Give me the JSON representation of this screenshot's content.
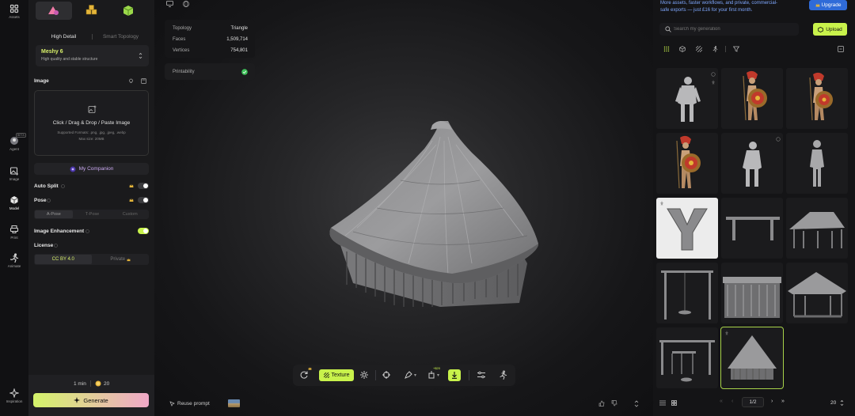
{
  "nav": {
    "assets": "Assets",
    "agent": "Agent",
    "agent_badge": "BETA",
    "image": "Image",
    "model": "Model",
    "print": "Print",
    "animate": "Animate",
    "inspiration": "Inspiration"
  },
  "panel": {
    "mode_tabs": [
      "High Detail",
      "Smart Topology"
    ],
    "model_select": {
      "name": "Meshy 6",
      "desc": "High quality and stable structure"
    },
    "image_label": "Image",
    "upload": {
      "title": "Click / Drag & Drop / Paste Image",
      "formats": "Supported Formats: .png, .jpg, .jpeg, .webp",
      "max": "Max size: 20MB"
    },
    "companion": "My Companion",
    "auto_split": "Auto Split",
    "pose": "Pose",
    "pose_options": [
      "A-Pose",
      "T-Pose",
      "Custom"
    ],
    "image_enhancement": "Image Enhancement",
    "license": "License",
    "license_options": [
      "CC BY 4.0",
      "Private"
    ],
    "time": "1 min",
    "credits": "20",
    "generate": "Generate"
  },
  "stats": {
    "rows": [
      {
        "k": "Topology",
        "v": "Triangle"
      },
      {
        "k": "Faces",
        "v": "1,509,714"
      },
      {
        "k": "Vertices",
        "v": "754,801"
      }
    ],
    "printability": "Printability"
  },
  "toolbar": {
    "texture": "Texture",
    "price_badge": "+$20"
  },
  "bottom": {
    "reuse_prompt": "Reuse prompt"
  },
  "right": {
    "banner_line1": "More assets, faster workflows, and private, commercial-",
    "banner_line2": "safe exports — just £16 for your first month.",
    "upgrade": "Upgrade",
    "search_placeholder": "Search my generation",
    "upload": "Upload",
    "page": "1/2",
    "per_page": "20"
  },
  "colors": {
    "accent": "#c8f24b",
    "generate_start": "#d4f36a",
    "generate_end": "#f0a8c8",
    "upgrade": "#2f6bd8"
  }
}
